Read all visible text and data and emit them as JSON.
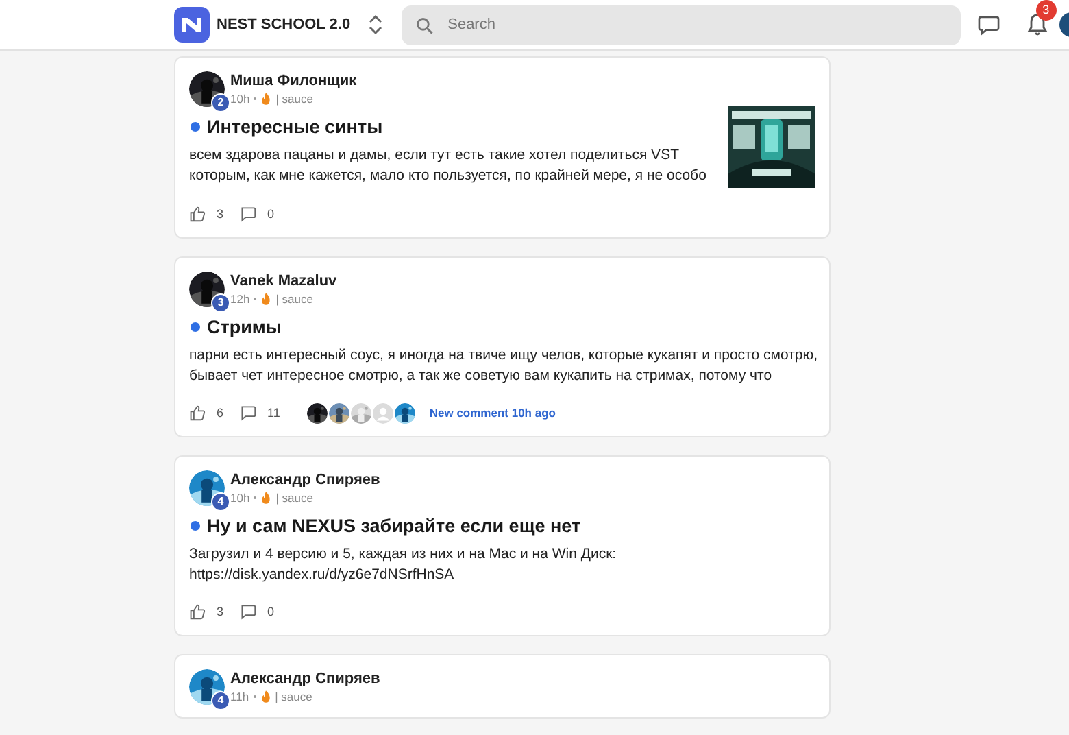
{
  "header": {
    "brand": "NEST SCHOOL 2.0",
    "search": {
      "placeholder": "Search"
    },
    "notifications": "3"
  },
  "posts": [
    {
      "author": "Миша Филонщик",
      "rank": "2",
      "time": "10h",
      "category": "| sauce",
      "title": "Интересные синты",
      "unread": true,
      "body": [
        "всем здарова пацаны и дамы, если тут есть такие хотел поделиться VST",
        "которым, как мне кажется, мало кто пользуется, по крайней мере, я не особо"
      ],
      "likes": "3",
      "comments": "0",
      "thumbnail": {
        "kind": "picture"
      }
    },
    {
      "author": "Vanek Mazaluv",
      "rank": "3",
      "time": "12h",
      "category": "| sauce",
      "title": "Стримы",
      "unread": true,
      "body": [
        "парни есть интересный соус, я иногда на твиче ищу челов, которые кукапят и просто смотрю,",
        "бывает чет интересное смотрю, а так же советую вам кукапить на стримах, потому что"
      ],
      "likes": "6",
      "comments": "11",
      "commenters": [
        {
          "kind": "picture"
        },
        {
          "kind": "picture"
        },
        {
          "kind": "picture"
        },
        {
          "kind": "placeholder"
        },
        {
          "kind": "picture"
        }
      ],
      "last_comment": "New comment 10h ago"
    },
    {
      "author": "Александр Спиряев",
      "rank": "4",
      "time": "10h",
      "category": "| sauce",
      "title": "Ну и сам NEXUS забирайте если еще нет",
      "unread": true,
      "body": [
        "Загрузил и 4 версию и 5, каждая из них и на Mac и на Win Диск:",
        "https://disk.yandex.ru/d/yz6e7dNSrfHnSA"
      ],
      "likes": "3",
      "comments": "0"
    },
    {
      "author": "Александр Спиряев",
      "rank": "4",
      "time": "11h",
      "category": "| sauce"
    }
  ]
}
